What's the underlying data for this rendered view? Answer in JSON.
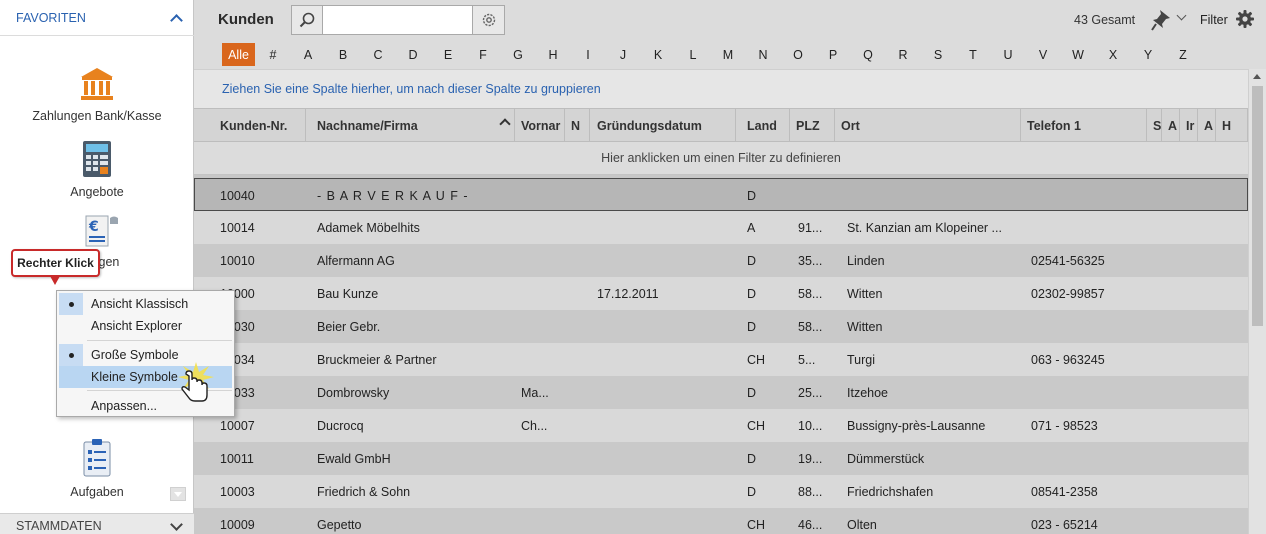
{
  "sidebar": {
    "favorites_label": "FAVORITEN",
    "stammdaten_label": "STAMMDATEN",
    "items": [
      {
        "label": "Zahlungen Bank/Kasse",
        "icon": "bank-icon"
      },
      {
        "label": "Angebote",
        "icon": "calculator-icon"
      },
      {
        "label": "ungen",
        "icon": "euro-document-icon"
      },
      {
        "label": "Aufgaben",
        "icon": "task-list-icon"
      }
    ]
  },
  "callout": {
    "text": "Rechter Klick"
  },
  "context_menu": {
    "items": [
      {
        "label": "Ansicht Klassisch",
        "checked": true
      },
      {
        "label": "Ansicht Explorer",
        "checked": false
      },
      {
        "label": "Große Symbole",
        "checked": true
      },
      {
        "label": "Kleine Symbole",
        "checked": false,
        "highlighted": true
      },
      {
        "label": "Anpassen...",
        "checked": false
      }
    ]
  },
  "toolbar": {
    "title": "Kunden",
    "search_value": "",
    "total_label": "43 Gesamt",
    "filter_label": "Filter"
  },
  "alphabet": [
    "Alle",
    "#",
    "A",
    "B",
    "C",
    "D",
    "E",
    "F",
    "G",
    "H",
    "I",
    "J",
    "K",
    "L",
    "M",
    "N",
    "O",
    "P",
    "Q",
    "R",
    "S",
    "T",
    "U",
    "V",
    "W",
    "X",
    "Y",
    "Z"
  ],
  "grid": {
    "group_hint": "Ziehen Sie eine Spalte hierher, um nach dieser Spalte zu gruppieren",
    "filter_hint": "Hier anklicken um einen Filter zu definieren",
    "columns": [
      "Kunden-Nr.",
      "Nachname/Firma",
      "Vornar",
      "N",
      "Gründungsdatum",
      "Land",
      "PLZ",
      "Ort",
      "Telefon 1",
      "S",
      "A",
      "Ir",
      "A",
      "H"
    ],
    "rows": [
      [
        "10040",
        "- B A R V E R K A U F -",
        "",
        "",
        "",
        "D",
        "",
        "",
        ""
      ],
      [
        "10014",
        "Adamek Möbelhits",
        "",
        "",
        "",
        "A",
        "91...",
        "St. Kanzian am Klopeiner ...",
        ""
      ],
      [
        "10010",
        "Alfermann AG",
        "",
        "",
        "",
        "D",
        "35...",
        "Linden",
        "02541-56325"
      ],
      [
        "10000",
        "Bau Kunze",
        "",
        "",
        "17.12.2011",
        "D",
        "58...",
        "Witten",
        "02302-99857"
      ],
      [
        "10030",
        "Beier Gebr.",
        "",
        "",
        "",
        "D",
        "58...",
        "Witten",
        ""
      ],
      [
        "10034",
        "Bruckmeier & Partner",
        "",
        "",
        "",
        "CH",
        "5...",
        "Turgi",
        "063 - 963245"
      ],
      [
        "10033",
        "Dombrowsky",
        "Ma...",
        "",
        "",
        "D",
        "25...",
        "Itzehoe",
        ""
      ],
      [
        "10007",
        "Ducrocq",
        "Ch...",
        "",
        "",
        "CH",
        "10...",
        "Bussigny-près-Lausanne",
        "071 - 98523"
      ],
      [
        "10011",
        "Ewald GmbH",
        "",
        "",
        "",
        "D",
        "19...",
        "Dümmerstück",
        ""
      ],
      [
        "10003",
        "Friedrich & Sohn",
        "",
        "",
        "",
        "D",
        "88...",
        "Friedrichshafen",
        "08541-2358"
      ],
      [
        "10009",
        "Gepetto",
        "",
        "",
        "",
        "CH",
        "46...",
        "Olten",
        "023 - 65214"
      ]
    ]
  },
  "colors": {
    "accent_orange": "#d9661c",
    "link_blue": "#2a62b0",
    "callout_red": "#c82a2a",
    "bank_orange": "#e8821e",
    "doc_blue": "#2b63b6"
  }
}
